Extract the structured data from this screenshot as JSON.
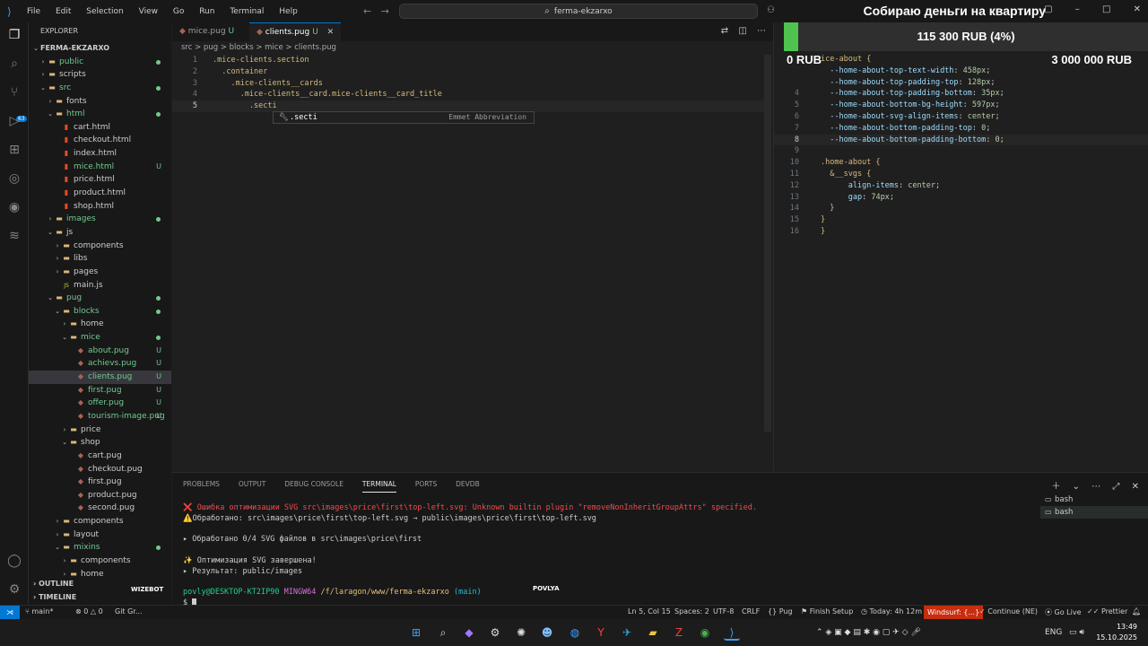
{
  "titlebar": {
    "menu": [
      "File",
      "Edit",
      "Selection",
      "View",
      "Go",
      "Run",
      "Terminal",
      "Help"
    ],
    "search": "ferma-ekzarxo"
  },
  "activity_badge": "63",
  "explorer": {
    "header": "EXPLORER",
    "root": "FERMA-EKZARXO",
    "items": [
      {
        "label": "public",
        "kind": "folder",
        "depth": 1,
        "open": false,
        "mark": "dot"
      },
      {
        "label": "scripts",
        "kind": "folder",
        "depth": 1,
        "open": false,
        "mark": ""
      },
      {
        "label": "src",
        "kind": "folder",
        "depth": 1,
        "open": true,
        "mark": "dot"
      },
      {
        "label": "fonts",
        "kind": "folder",
        "depth": 2,
        "open": false,
        "mark": ""
      },
      {
        "label": "html",
        "kind": "folder",
        "depth": 2,
        "open": true,
        "mark": "dot"
      },
      {
        "label": "cart.html",
        "kind": "html",
        "depth": 3,
        "mark": ""
      },
      {
        "label": "checkout.html",
        "kind": "html",
        "depth": 3,
        "mark": ""
      },
      {
        "label": "index.html",
        "kind": "html",
        "depth": 3,
        "mark": ""
      },
      {
        "label": "mice.html",
        "kind": "html",
        "depth": 3,
        "mark": "U"
      },
      {
        "label": "price.html",
        "kind": "html",
        "depth": 3,
        "mark": ""
      },
      {
        "label": "product.html",
        "kind": "html",
        "depth": 3,
        "mark": ""
      },
      {
        "label": "shop.html",
        "kind": "html",
        "depth": 3,
        "mark": ""
      },
      {
        "label": "images",
        "kind": "folder",
        "depth": 2,
        "open": false,
        "mark": "dot"
      },
      {
        "label": "js",
        "kind": "folder",
        "depth": 2,
        "open": true,
        "mark": ""
      },
      {
        "label": "components",
        "kind": "folder",
        "depth": 3,
        "open": false,
        "mark": ""
      },
      {
        "label": "libs",
        "kind": "folder",
        "depth": 3,
        "open": false,
        "mark": ""
      },
      {
        "label": "pages",
        "kind": "folder",
        "depth": 3,
        "open": false,
        "mark": ""
      },
      {
        "label": "main.js",
        "kind": "js",
        "depth": 3,
        "mark": ""
      },
      {
        "label": "pug",
        "kind": "folder",
        "depth": 2,
        "open": true,
        "mark": "dot"
      },
      {
        "label": "blocks",
        "kind": "folder",
        "depth": 3,
        "open": true,
        "mark": "dot"
      },
      {
        "label": "home",
        "kind": "folder",
        "depth": 4,
        "open": false,
        "mark": ""
      },
      {
        "label": "mice",
        "kind": "folder",
        "depth": 4,
        "open": true,
        "mark": "dot"
      },
      {
        "label": "about.pug",
        "kind": "pug",
        "depth": 5,
        "mark": "U"
      },
      {
        "label": "achievs.pug",
        "kind": "pug",
        "depth": 5,
        "mark": "U"
      },
      {
        "label": "clients.pug",
        "kind": "pug",
        "depth": 5,
        "mark": "U",
        "selected": true
      },
      {
        "label": "first.pug",
        "kind": "pug",
        "depth": 5,
        "mark": "U"
      },
      {
        "label": "offer.pug",
        "kind": "pug",
        "depth": 5,
        "mark": "U"
      },
      {
        "label": "tourism-image.pug",
        "kind": "pug",
        "depth": 5,
        "mark": "U"
      },
      {
        "label": "price",
        "kind": "folder",
        "depth": 4,
        "open": false,
        "mark": ""
      },
      {
        "label": "shop",
        "kind": "folder",
        "depth": 4,
        "open": true,
        "mark": ""
      },
      {
        "label": "cart.pug",
        "kind": "pug",
        "depth": 5,
        "mark": ""
      },
      {
        "label": "checkout.pug",
        "kind": "pug",
        "depth": 5,
        "mark": ""
      },
      {
        "label": "first.pug",
        "kind": "pug",
        "depth": 5,
        "mark": ""
      },
      {
        "label": "product.pug",
        "kind": "pug",
        "depth": 5,
        "mark": ""
      },
      {
        "label": "second.pug",
        "kind": "pug",
        "depth": 5,
        "mark": ""
      },
      {
        "label": "components",
        "kind": "folder",
        "depth": 3,
        "open": false,
        "mark": ""
      },
      {
        "label": "layout",
        "kind": "folder",
        "depth": 3,
        "open": false,
        "mark": ""
      },
      {
        "label": "mixins",
        "kind": "folder",
        "depth": 3,
        "open": true,
        "mark": "dot"
      },
      {
        "label": "components",
        "kind": "folder",
        "depth": 4,
        "open": false,
        "mark": ""
      },
      {
        "label": "home",
        "kind": "folder",
        "depth": 4,
        "open": false,
        "mark": ""
      }
    ],
    "outline": "OUTLINE",
    "timeline": "TIMELINE"
  },
  "tabs": [
    {
      "label": "mice.pug",
      "mark": "U",
      "active": false
    },
    {
      "label": "clients.pug",
      "mark": "U",
      "active": true
    }
  ],
  "breadcrumb": "src > pug > blocks > mice > clients.pug",
  "code": [
    {
      "n": "1",
      "text": ".mice-clients.section"
    },
    {
      "n": "2",
      "text": "  .container"
    },
    {
      "n": "3",
      "text": "    .mice-clients__cards"
    },
    {
      "n": "4",
      "text": "      .mice-clients__card.mice-clients__card_title"
    },
    {
      "n": "5",
      "text": "        .secti"
    }
  ],
  "suggest": {
    "label": ".secti",
    "detail": "Emmet Abbreviation"
  },
  "right_code": [
    {
      "n": "",
      "sel": "ice-about {"
    },
    {
      "n": "",
      "prop": "--home-about-top-text-width",
      "val": "458px"
    },
    {
      "n": "",
      "prop": "--home-about-top-padding-top",
      "val": "128px"
    },
    {
      "n": "4",
      "prop": "--home-about-top-padding-bottom",
      "val": "35px"
    },
    {
      "n": "5",
      "prop": "--home-about-bottom-bg-height",
      "val": "597px"
    },
    {
      "n": "6",
      "prop": "--home-about-svg-align-items",
      "val": "center"
    },
    {
      "n": "7",
      "prop": "--home-about-bottom-padding-top",
      "val": "0"
    },
    {
      "n": "8",
      "prop": "--home-about-bottom-padding-bottom",
      "val": "0"
    },
    {
      "n": "9",
      "raw": ""
    },
    {
      "n": "10",
      "raw": ".home-about {"
    },
    {
      "n": "11",
      "raw": "  &__svgs {"
    },
    {
      "n": "12",
      "prop": "    align-items",
      "val": "center"
    },
    {
      "n": "13",
      "prop": "    gap",
      "val": "74px"
    },
    {
      "n": "14",
      "raw": "  }"
    },
    {
      "n": "15",
      "raw": "}"
    },
    {
      "n": "16",
      "raw": "}"
    }
  ],
  "donation": {
    "title": "Собираю деньги на квартиру",
    "amount": "115 300 RUB (4%)",
    "progress": 0.04,
    "min": "0 RUB",
    "max": "3 000 000 RUB"
  },
  "panel": {
    "tabs": [
      "PROBLEMS",
      "OUTPUT",
      "DEBUG CONSOLE",
      "TERMINAL",
      "PORTS",
      "DEVDB"
    ],
    "active_tab": "TERMINAL",
    "terminal": [
      {
        "cls": "t-red",
        "prefix": "❌ ",
        "text": "Ошибка оптимизации SVG src\\images\\price\\first\\top-left.svg: Unknown builtin plugin \"removeNonInheritGroupAttrs\" specified."
      },
      {
        "cls": "t-yel",
        "prefix": "⚠️",
        "text": "Обработано: src\\images\\price\\first\\top-left.svg → public\\images\\price\\first\\top-left.svg"
      },
      {
        "cls": "",
        "prefix": "",
        "text": ""
      },
      {
        "cls": "",
        "prefix": "▸ ",
        "text": "Обработано 0/4 SVG файлов в src\\images\\price\\first"
      },
      {
        "cls": "",
        "prefix": "",
        "text": ""
      },
      {
        "cls": "t-yw",
        "prefix": "✨ ",
        "text": "Оптимизация SVG завершена!"
      },
      {
        "cls": "",
        "prefix": "▸ ",
        "text": "Результат: public/images"
      }
    ],
    "prompt_user": "povly@DESKTOP-KT2IP90",
    "prompt_shell": "MINGW64",
    "prompt_path": "/f/laragon/www/ferma-ekzarxo",
    "prompt_branch": "(main)",
    "prompt_symbol": "$",
    "terminals": [
      "bash",
      "bash"
    ]
  },
  "overlay_labels": {
    "wizebot": "WIZEBOT",
    "povlya": "POVLYA"
  },
  "status": {
    "branch": "main*",
    "errors": "0",
    "warnings": "0",
    "git": "Git Gr...",
    "position": "Ln 5, Col 15",
    "spaces": "Spaces: 2",
    "encoding": "UTF-8",
    "eol": "CRLF",
    "language": "Pug",
    "setup": "Finish Setup",
    "time": "Today: 4h 12m",
    "windsurf": "Windsurf: {...}",
    "continue": "Continue (NE)",
    "golive": "Go Live",
    "prettier": "Prettier"
  },
  "taskbar": {
    "lang": "ENG",
    "time": "13:49",
    "date": "15.10.2025"
  }
}
